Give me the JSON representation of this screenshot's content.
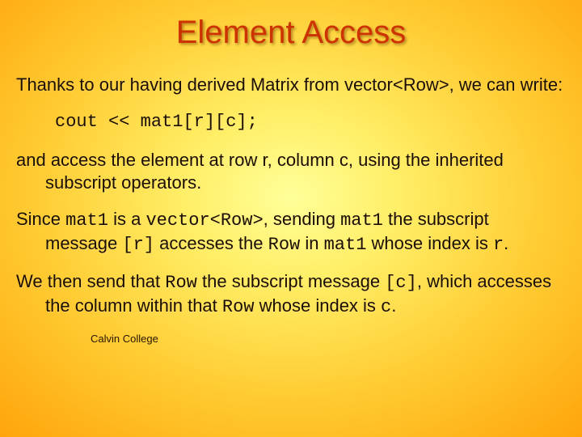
{
  "title": "Element Access",
  "p1_a": "Thanks to our having derived Matrix from vector<Row>, ",
  "p1_b": "we can write:",
  "code1": "cout << mat1[r][c];",
  "p2_a": "and access the element at row r, column c, ",
  "p2_b": "using the inherited subscript operators.",
  "p3": {
    "t1": "Since ",
    "m1": "mat1",
    "t2": " is a ",
    "m2": "vector<Row>",
    "t3": ", sending ",
    "m3": "mat1",
    "t4": " the subscript message ",
    "m4": "[r]",
    "t5": " accesses the ",
    "m5": "Row",
    "t6": " in ",
    "m6": "mat1",
    "t7": " whose index is ",
    "m7": "r",
    "t8": "."
  },
  "p4": {
    "t1": "We then send that ",
    "m1": "Row",
    "t2": " the subscript message ",
    "m2": "[c]",
    "t3": ", which accesses the column within that ",
    "m3": "Row",
    "t4": " whose index is ",
    "m4": "c",
    "t5": "."
  },
  "footer": "Calvin College"
}
